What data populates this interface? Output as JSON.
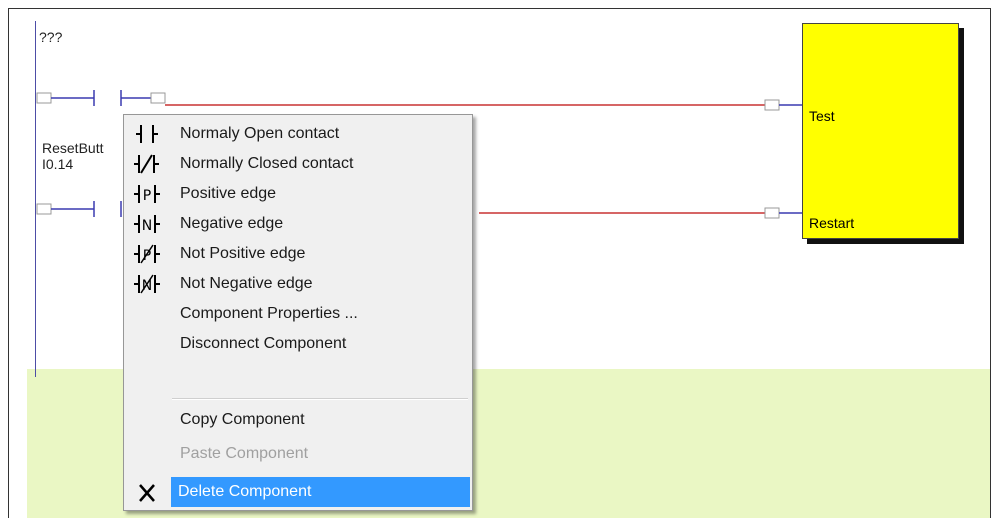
{
  "ladder": {
    "rung_label": "???",
    "contact_tag": "ResetButt",
    "contact_address": "I0.14",
    "function_block": {
      "color": "#ffff00",
      "pins": [
        "Test",
        "Restart"
      ]
    },
    "lower_rung_color": "#eaf7c4",
    "wire_color": "#c83232"
  },
  "context_menu": {
    "items": [
      {
        "label": "Normaly Open contact",
        "icon": "normally-open-contact-icon",
        "enabled": true
      },
      {
        "label": "Normally Closed contact",
        "icon": "normally-closed-contact-icon",
        "enabled": true
      },
      {
        "label": "Positive edge",
        "icon": "positive-edge-icon",
        "enabled": true
      },
      {
        "label": "Negative edge",
        "icon": "negative-edge-icon",
        "enabled": true
      },
      {
        "label": "Not Positive edge",
        "icon": "not-positive-edge-icon",
        "enabled": true
      },
      {
        "label": "Not Negative edge",
        "icon": "not-negative-edge-icon",
        "enabled": true
      },
      {
        "label": "Component Properties ...",
        "enabled": true
      },
      {
        "label": "Disconnect Component",
        "enabled": true
      },
      {
        "label": "Copy Component",
        "enabled": true
      },
      {
        "label": "Paste Component",
        "enabled": false
      },
      {
        "label": "Delete Component",
        "icon": "delete-x-icon",
        "enabled": true,
        "selected": true
      }
    ],
    "highlight_color": "#3399ff"
  }
}
